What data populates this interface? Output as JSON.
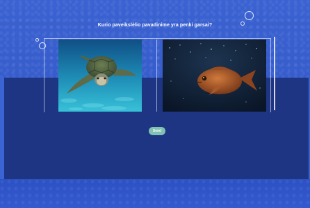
{
  "question": {
    "text": "Kurio paveikslėlio pavadinime yra penki garsai?"
  },
  "cards": [
    {
      "name": "sea-turtle-image",
      "icon": "sea-turtle-photo"
    },
    {
      "name": "fish-image",
      "icon": "fish-photo"
    }
  ],
  "send_button": {
    "label": "Send"
  },
  "decorations": {
    "bubbles": [
      "bubble-icon",
      "bubble-icon",
      "bubble-icon",
      "bubble-icon"
    ]
  },
  "colors": {
    "top_background": "#3b62d2",
    "dark_band": "#1e3584",
    "send_button": "#7fc1b3"
  }
}
